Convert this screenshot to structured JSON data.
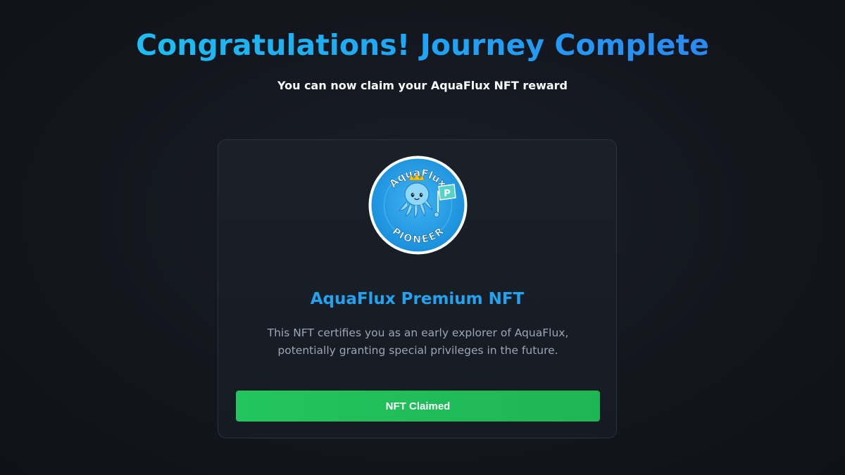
{
  "header": {
    "title": "Congratulations! Journey Complete",
    "subtitle": "You can now claim your AquaFlux NFT reward"
  },
  "nft_card": {
    "badge": {
      "top_text": "AquaFlux",
      "bottom_text": "PIONEER",
      "flag_letter": "P",
      "icon": "octopus-mascot-icon"
    },
    "title": "AquaFlux Premium NFT",
    "description": "This NFT certifies you as an early explorer of AquaFlux, potentially granting special privileges in the future.",
    "button_label": "NFT Claimed"
  },
  "colors": {
    "background": "#13161d",
    "title_gradient_start": "#1ec8f0",
    "title_gradient_end": "#2f7cf2",
    "accent_blue": "#22a2ef",
    "button_green": "#22c55e",
    "badge_blue": "#1e9be6"
  }
}
